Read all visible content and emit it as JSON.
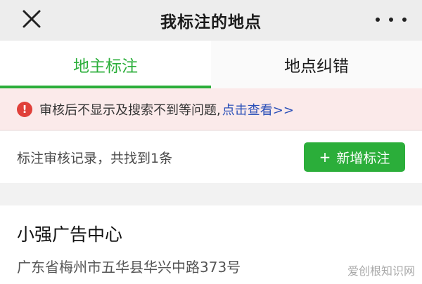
{
  "header": {
    "title": "我标注的地点",
    "close_icon": "close-icon",
    "more_icon": "more-icon"
  },
  "tabs": [
    {
      "label": "地主标注",
      "active": true
    },
    {
      "label": "地点纠错",
      "active": false
    }
  ],
  "notice": {
    "icon_text": "!",
    "text": "审核后不显示及搜索不到等问题,",
    "link": "点击查看>>"
  },
  "records": {
    "summary": "标注审核记录，共找到1条",
    "add_button": "新增标注",
    "add_plus": "+"
  },
  "place": {
    "name": "小强广告中心",
    "address": "广东省梅州市五华县华兴中路373号"
  },
  "watermark": "爱创根知识网",
  "colors": {
    "accent": "#2bae3a",
    "link": "#2a4fb8",
    "alert": "#e0403a",
    "notice_bg": "#fbeaea"
  }
}
